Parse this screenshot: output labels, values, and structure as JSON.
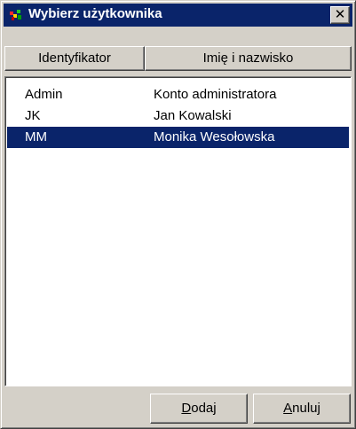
{
  "window": {
    "title": "Wybierz użytkownika",
    "close_glyph": "✕"
  },
  "columns": [
    {
      "label": "Identyfikator"
    },
    {
      "label": "Imię i nazwisko"
    }
  ],
  "rows": [
    {
      "id": "Admin",
      "name": "Konto administratora",
      "selected": false
    },
    {
      "id": "JK",
      "name": "Jan Kowalski",
      "selected": false
    },
    {
      "id": "MM",
      "name": "Monika Wesołowska",
      "selected": true
    }
  ],
  "buttons": {
    "add": {
      "mnemonic": "D",
      "rest": "odaj"
    },
    "cancel": {
      "mnemonic": "A",
      "rest": "nuluj"
    }
  },
  "colors": {
    "titlebar": "#0a246a",
    "selection": "#0a246a",
    "face": "#d4d0c8"
  },
  "icons": {
    "app": "users-icon",
    "close": "close-icon"
  }
}
